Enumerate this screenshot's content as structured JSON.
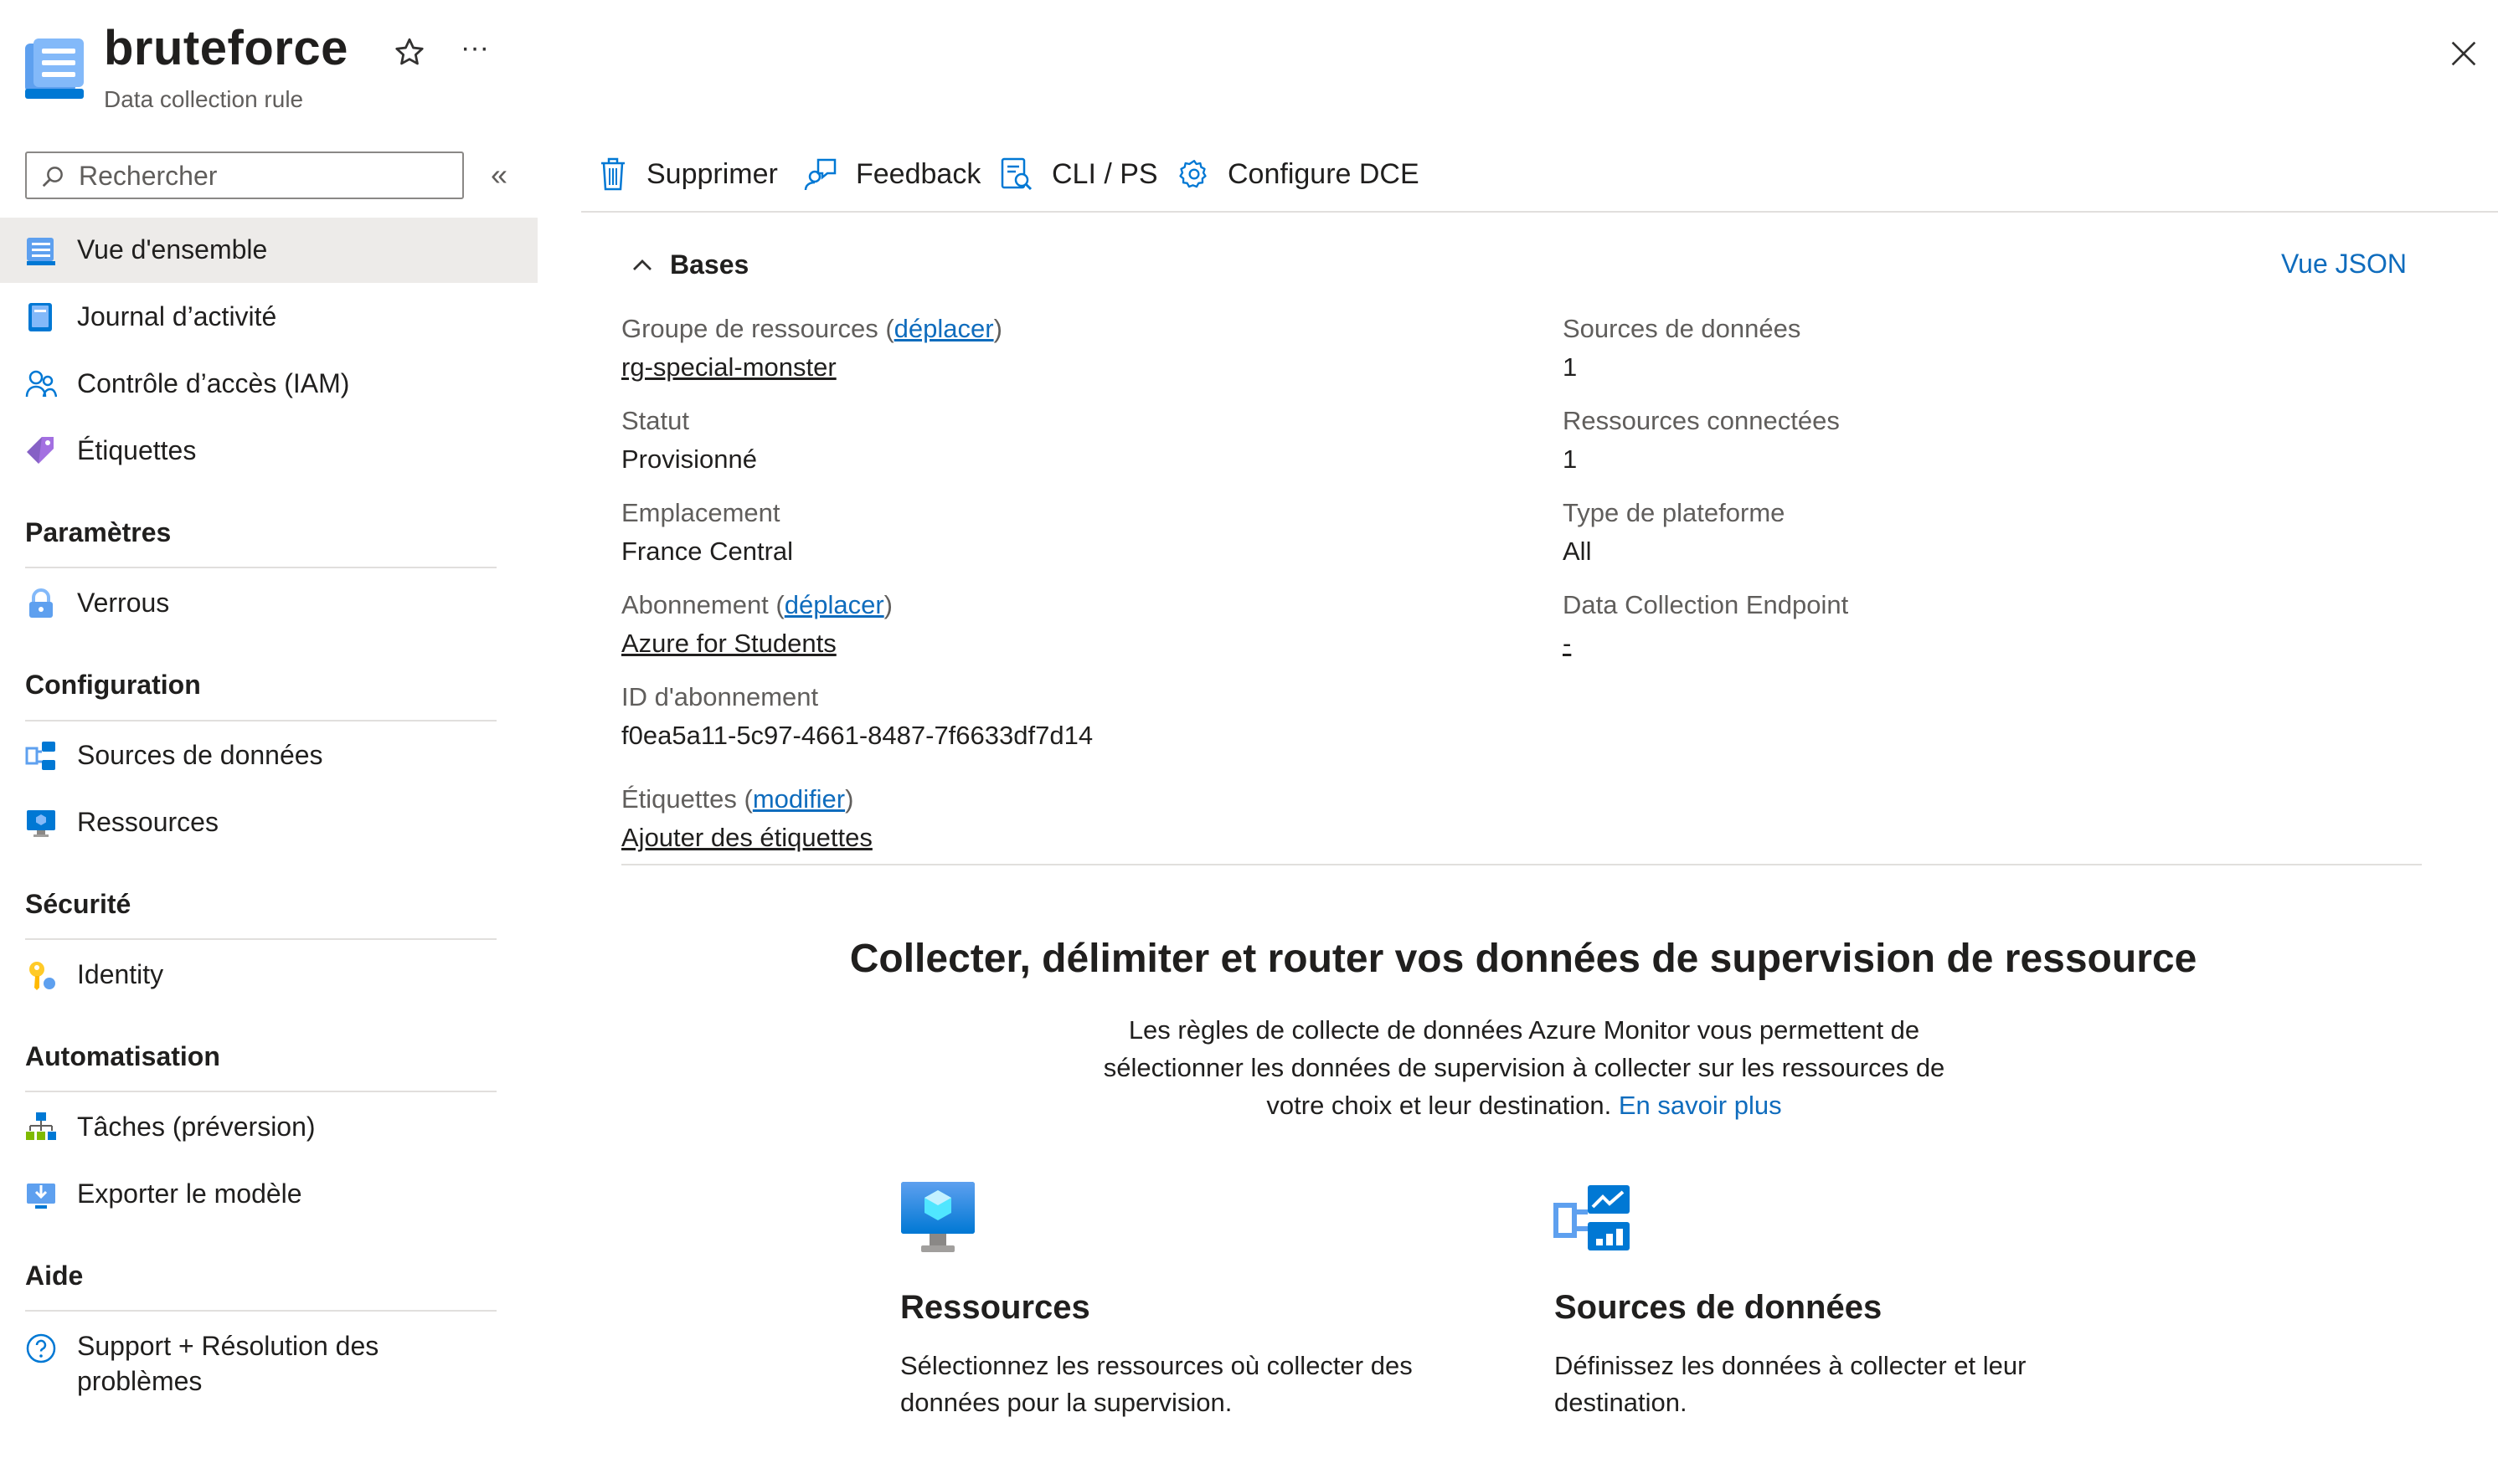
{
  "header": {
    "title": "bruteforce",
    "subtitle": "Data collection rule",
    "more_label": "···"
  },
  "search": {
    "placeholder": "Rechercher",
    "value": ""
  },
  "sidebar": {
    "collapse_label": "«",
    "items": [
      {
        "label": "Vue d'ensemble",
        "icon": "overview-icon",
        "active": true
      },
      {
        "label": "Journal d’activité",
        "icon": "activity-log-icon"
      },
      {
        "label": "Contrôle d’accès (IAM)",
        "icon": "iam-icon"
      },
      {
        "label": "Étiquettes",
        "icon": "tag-icon"
      }
    ],
    "sections": [
      {
        "title": "Paramètres",
        "items": [
          {
            "label": "Verrous",
            "icon": "lock-icon"
          }
        ]
      },
      {
        "title": "Configuration",
        "items": [
          {
            "label": "Sources de données",
            "icon": "data-sources-icon"
          },
          {
            "label": "Ressources",
            "icon": "resources-icon"
          }
        ]
      },
      {
        "title": "Sécurité",
        "items": [
          {
            "label": "Identity",
            "icon": "key-icon"
          }
        ]
      },
      {
        "title": "Automatisation",
        "items": [
          {
            "label": "Tâches (préversion)",
            "icon": "tasks-icon"
          },
          {
            "label": "Exporter le modèle",
            "icon": "export-icon"
          }
        ]
      },
      {
        "title": "Aide",
        "items": [
          {
            "label_line1": "Support + Résolution des",
            "label_line2": "problèmes",
            "icon": "help-icon"
          }
        ]
      }
    ]
  },
  "toolbar": {
    "delete_label": "Supprimer",
    "feedback_label": "Feedback",
    "cli_label": "CLI / PS",
    "dce_label": "Configure DCE"
  },
  "essentials": {
    "title": "Bases",
    "json_link": "Vue JSON",
    "left": {
      "resource_group_label": "Groupe de ressources",
      "resource_group_move": "déplacer",
      "resource_group_value": "rg-special-monster",
      "status_label": "Statut",
      "status_value": "Provisionné",
      "location_label": "Emplacement",
      "location_value": "France Central",
      "subscription_label": "Abonnement",
      "subscription_move": "déplacer",
      "subscription_value": "Azure for Students",
      "subscription_id_label": "ID d'abonnement",
      "subscription_id_value": "f0ea5a11-5c97-4661-8487-7f6633df7d14",
      "tags_label": "Étiquettes",
      "tags_edit": "modifier",
      "tags_add": "Ajouter des étiquettes"
    },
    "right": {
      "data_sources_label": "Sources de données",
      "data_sources_value": "1",
      "connected_label": "Ressources connectées",
      "connected_value": "1",
      "platform_label": "Type de plateforme",
      "platform_value": "All",
      "dce_label": "Data Collection Endpoint",
      "dce_value": "-"
    }
  },
  "hero": {
    "title": "Collecter, délimiter et router vos données de supervision de ressource",
    "desc_line1": "Les règles de collecte de données Azure Monitor vous permettent de",
    "desc_line2": "sélectionner les données de supervision à collecter sur les ressources de",
    "desc_line3": "votre choix et leur destination.",
    "learn_more": "En savoir plus"
  },
  "cards": [
    {
      "title": "Ressources",
      "desc_line1": "Sélectionnez les ressources où collecter des",
      "desc_line2": "données pour la supervision.",
      "icon": "resources-monitor-icon"
    },
    {
      "title": "Sources de données",
      "desc_line1": "Définissez les données à collecter et leur",
      "desc_line2": "destination.",
      "icon": "data-sources-chart-icon"
    }
  ],
  "colors": {
    "link": "#0f6cbd",
    "accent": "#0078d4",
    "active_bg": "#edebe9"
  }
}
